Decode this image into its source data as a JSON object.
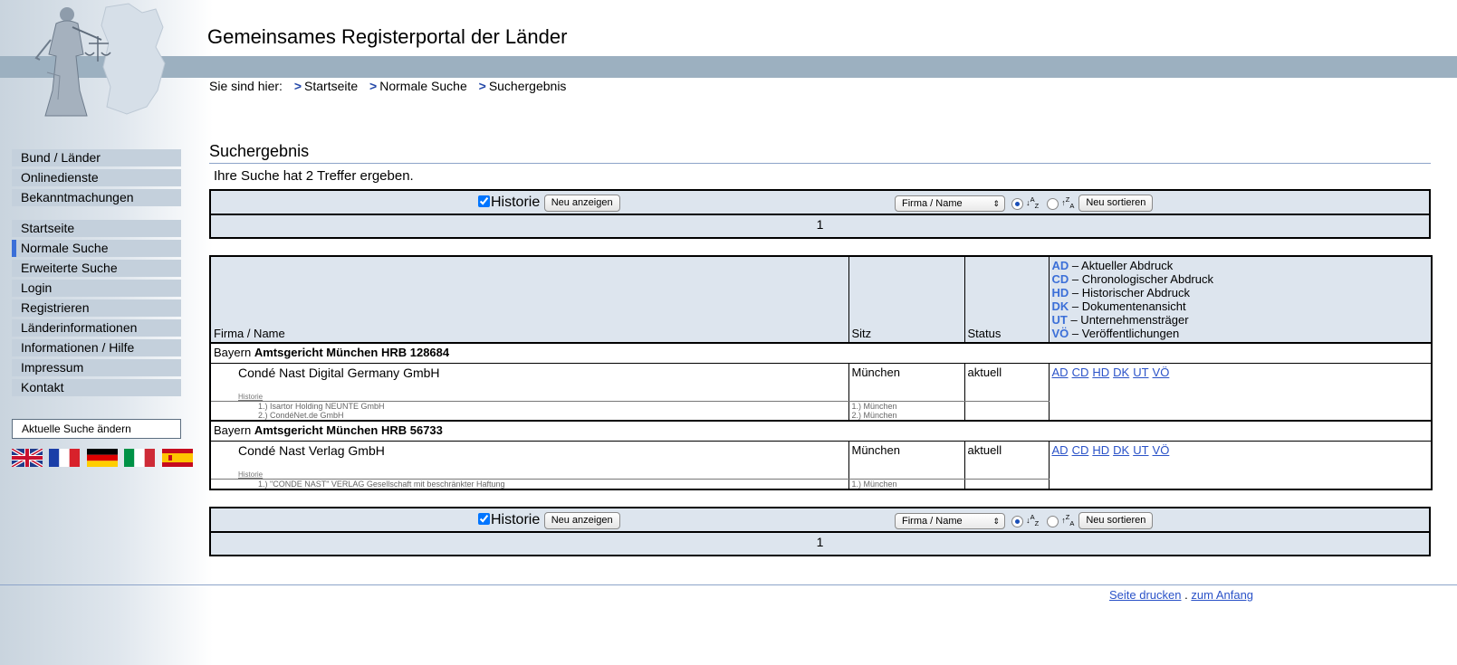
{
  "header": {
    "title": "Gemeinsames Registerportal der Länder",
    "breadcrumb_prefix": "Sie sind hier:",
    "breadcrumbs": [
      "Startseite",
      "Normale Suche",
      "Suchergebnis"
    ]
  },
  "nav": {
    "group1": [
      "Bund / Länder",
      "Onlinedienste",
      "Bekanntmachungen"
    ],
    "group2": [
      "Startseite",
      "Normale Suche",
      "Erweiterte Suche",
      "Login",
      "Registrieren",
      "Länderinformationen",
      "Informationen / Hilfe",
      "Impressum",
      "Kontakt"
    ],
    "active": "Normale Suche",
    "change_search": "Aktuelle Suche ändern",
    "flags": [
      "english-flag",
      "french-flag",
      "german-flag",
      "italian-flag",
      "spanish-flag"
    ]
  },
  "results": {
    "title": "Suchergebnis",
    "hits_text": "Ihre Suche hat 2 Treffer ergeben.",
    "historie_label": "Historie",
    "historie_checked": true,
    "show_button": "Neu anzeigen",
    "sort_field": "Firma / Name",
    "sort_button": "Neu sortieren",
    "page": "1",
    "columns": {
      "name": "Firma / Name",
      "sitz": "Sitz",
      "status": "Status"
    },
    "legend": [
      {
        "code": "AD",
        "text": "– Aktueller Abdruck"
      },
      {
        "code": "CD",
        "text": "– Chronologischer Abdruck"
      },
      {
        "code": "HD",
        "text": "– Historischer Abdruck"
      },
      {
        "code": "DK",
        "text": "– Dokumentenansicht"
      },
      {
        "code": "UT",
        "text": "– Unternehmensträger"
      },
      {
        "code": "VÖ",
        "text": "– Veröffentlichungen"
      }
    ],
    "entries": [
      {
        "state": "Bayern",
        "court": "Amtsgericht München HRB 128684",
        "name": "Condé Nast Digital Germany GmbH",
        "sitz": "München",
        "status": "aktuell",
        "history_label": "Historie",
        "history": [
          {
            "name": "1.) Isartor Holding NEUNTE GmbH",
            "sitz": "1.) München"
          },
          {
            "name": "2.) CondéNet.de GmbH",
            "sitz": "2.) München"
          }
        ],
        "links": [
          "AD",
          "CD",
          "HD",
          "DK",
          "UT",
          "VÖ"
        ]
      },
      {
        "state": "Bayern",
        "court": "Amtsgericht München HRB 56733",
        "name": "Condé Nast Verlag GmbH",
        "sitz": "München",
        "status": "aktuell",
        "history_label": "Historie",
        "history": [
          {
            "name": "1.) \"CONDE NAST\" VERLAG Gesellschaft mit beschränkter Haftung",
            "sitz": "1.) München"
          }
        ],
        "links": [
          "AD",
          "CD",
          "HD",
          "DK",
          "UT",
          "VÖ"
        ]
      }
    ]
  },
  "footer": {
    "print": "Seite drucken",
    "separator": ".",
    "top": "zum Anfang"
  },
  "colors": {
    "header_band": "#9cb0c0",
    "nav_item": "#c4d0dc",
    "table_header": "#dde5ee",
    "link": "#2a52c8",
    "legend_code": "#3b6fd8"
  }
}
